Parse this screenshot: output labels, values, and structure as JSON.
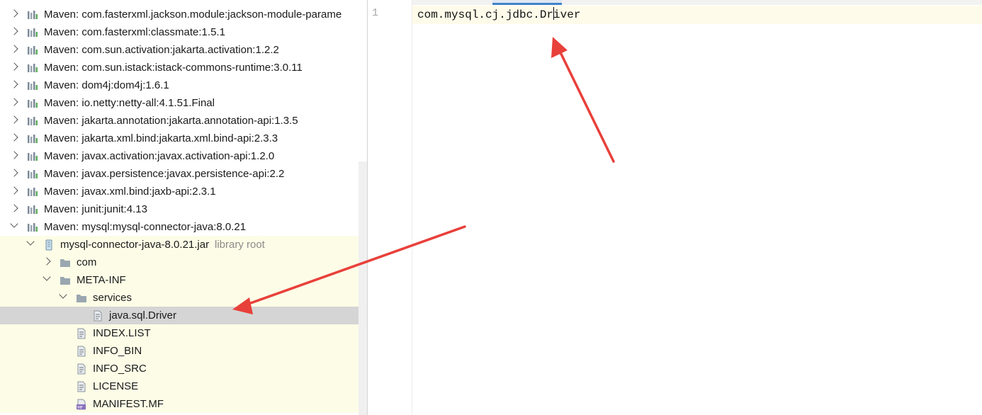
{
  "project_tree": {
    "rows": [
      {
        "label": "Maven: com.fasterxml.jackson.module:jackson-module-parame",
        "extra": "",
        "icon": "maven-library-icon",
        "expand": "right",
        "depth": 0
      },
      {
        "label": "Maven: com.fasterxml:classmate:1.5.1",
        "extra": "",
        "icon": "maven-library-icon",
        "expand": "right",
        "depth": 0
      },
      {
        "label": "Maven: com.sun.activation:jakarta.activation:1.2.2",
        "extra": "",
        "icon": "maven-library-icon",
        "expand": "right",
        "depth": 0
      },
      {
        "label": "Maven: com.sun.istack:istack-commons-runtime:3.0.11",
        "extra": "",
        "icon": "maven-library-icon",
        "expand": "right",
        "depth": 0
      },
      {
        "label": "Maven: dom4j:dom4j:1.6.1",
        "extra": "",
        "icon": "maven-library-icon",
        "expand": "right",
        "depth": 0
      },
      {
        "label": "Maven: io.netty:netty-all:4.1.51.Final",
        "extra": "",
        "icon": "maven-library-icon",
        "expand": "right",
        "depth": 0
      },
      {
        "label": "Maven: jakarta.annotation:jakarta.annotation-api:1.3.5",
        "extra": "",
        "icon": "maven-library-icon",
        "expand": "right",
        "depth": 0
      },
      {
        "label": "Maven: jakarta.xml.bind:jakarta.xml.bind-api:2.3.3",
        "extra": "",
        "icon": "maven-library-icon",
        "expand": "right",
        "depth": 0
      },
      {
        "label": "Maven: javax.activation:javax.activation-api:1.2.0",
        "extra": "",
        "icon": "maven-library-icon",
        "expand": "right",
        "depth": 0
      },
      {
        "label": "Maven: javax.persistence:javax.persistence-api:2.2",
        "extra": "",
        "icon": "maven-library-icon",
        "expand": "right",
        "depth": 0
      },
      {
        "label": "Maven: javax.xml.bind:jaxb-api:2.3.1",
        "extra": "",
        "icon": "maven-library-icon",
        "expand": "right",
        "depth": 0
      },
      {
        "label": "Maven: junit:junit:4.13",
        "extra": "",
        "icon": "maven-library-icon",
        "expand": "right",
        "depth": 0
      },
      {
        "label": "Maven: mysql:mysql-connector-java:8.0.21",
        "extra": "",
        "icon": "maven-library-icon",
        "expand": "down",
        "depth": 0
      },
      {
        "label": "mysql-connector-java-8.0.21.jar",
        "extra": "library root",
        "icon": "jar-icon",
        "expand": "down",
        "depth": 1
      },
      {
        "label": "com",
        "extra": "",
        "icon": "folder-icon",
        "expand": "right",
        "depth": 2
      },
      {
        "label": "META-INF",
        "extra": "",
        "icon": "folder-icon",
        "expand": "down",
        "depth": 2
      },
      {
        "label": "services",
        "extra": "",
        "icon": "folder-icon",
        "expand": "down",
        "depth": 3
      },
      {
        "label": "java.sql.Driver",
        "extra": "",
        "icon": "text-file-icon",
        "expand": "none",
        "depth": 4,
        "selected": true
      },
      {
        "label": "INDEX.LIST",
        "extra": "",
        "icon": "text-file-icon",
        "expand": "none",
        "depth": 3
      },
      {
        "label": "INFO_BIN",
        "extra": "",
        "icon": "text-file-icon",
        "expand": "none",
        "depth": 3
      },
      {
        "label": "INFO_SRC",
        "extra": "",
        "icon": "text-file-icon",
        "expand": "none",
        "depth": 3
      },
      {
        "label": "LICENSE",
        "extra": "",
        "icon": "text-file-icon",
        "expand": "none",
        "depth": 3
      },
      {
        "label": "MANIFEST.MF",
        "extra": "",
        "icon": "manifest-file-icon",
        "expand": "none",
        "depth": 3
      }
    ]
  },
  "editor": {
    "line_number": "1",
    "code_before_caret": "com.mysql.cj.jdbc.Dr",
    "code_after_caret": "iver"
  },
  "colors": {
    "library_highlight": "#fdfde7",
    "selection": "#d5d5d5",
    "current_line": "#fffbea",
    "annotation_arrow": "#e8403a"
  }
}
